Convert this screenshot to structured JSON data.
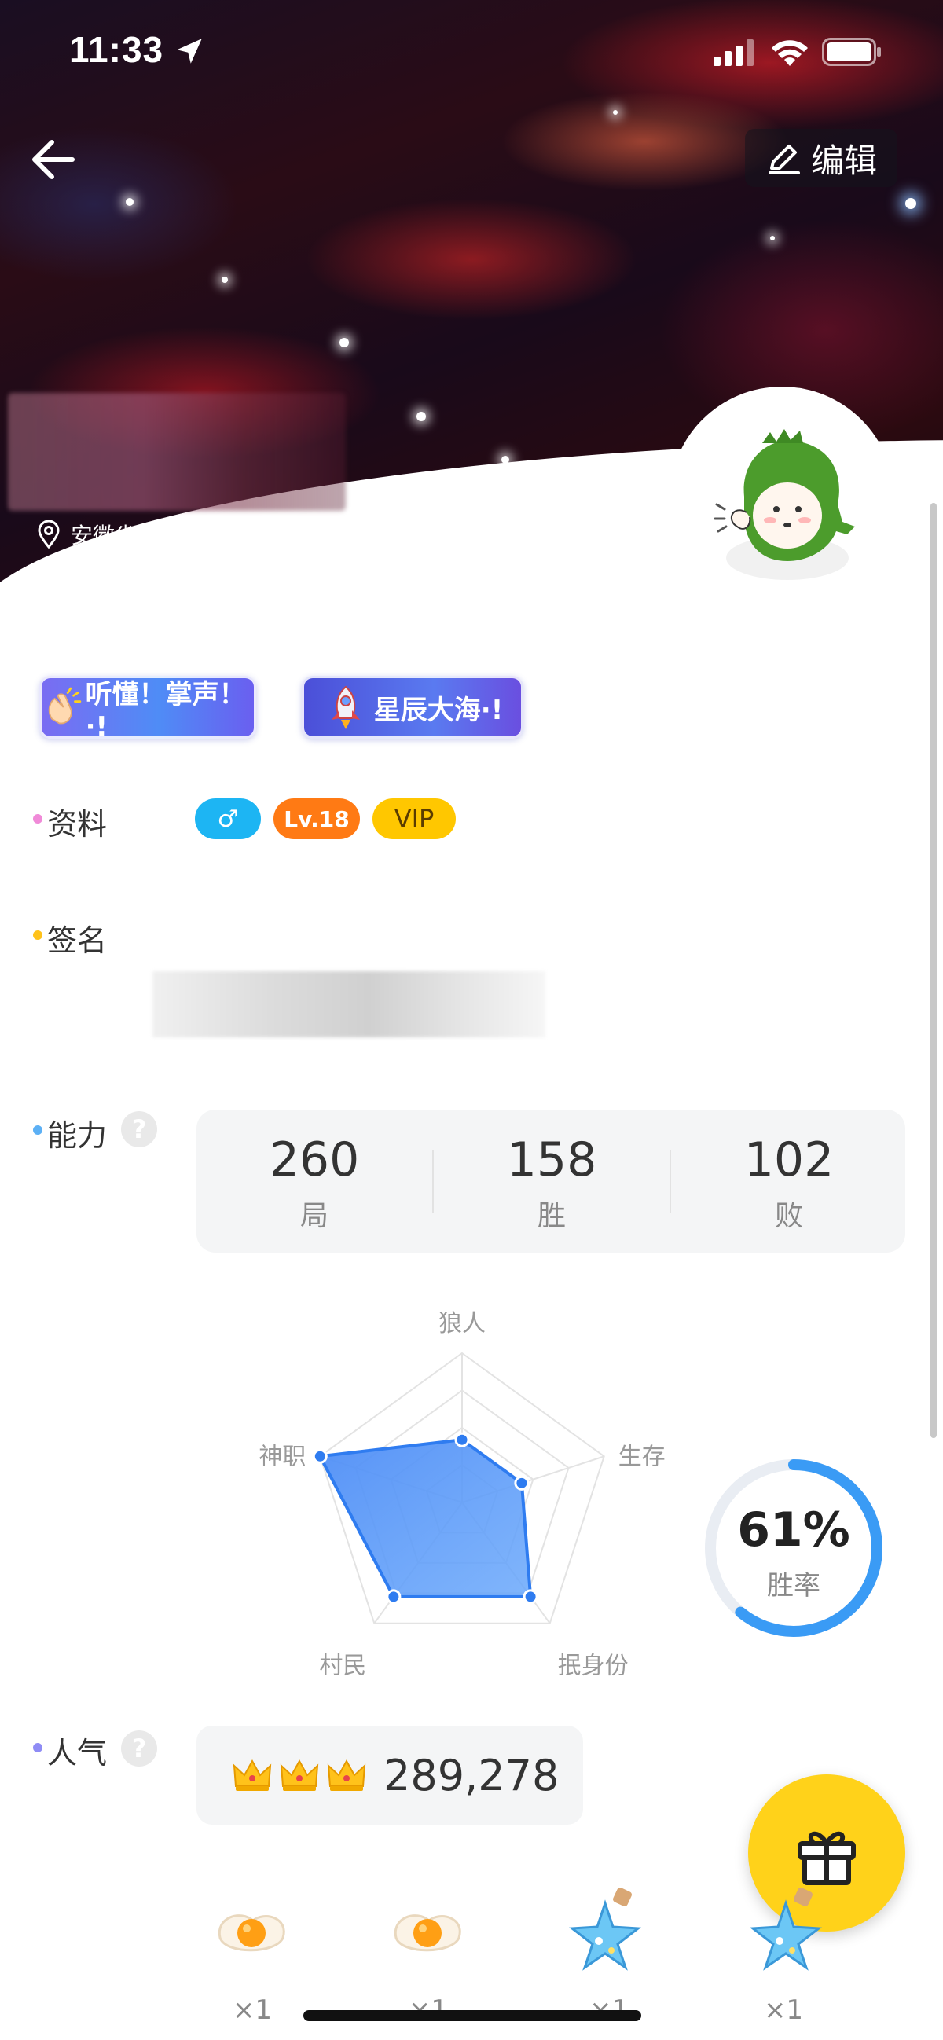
{
  "status_bar": {
    "time": "11:33",
    "icons": [
      "location-arrow-icon",
      "signal-icon",
      "wifi-icon",
      "battery-icon"
    ]
  },
  "header": {
    "back_icon": "arrow-left-icon",
    "edit_label": "编辑",
    "edit_icon": "pencil-icon",
    "location": "安徽省"
  },
  "badges": [
    {
      "label": "听懂！掌声！·!",
      "icon": "clapping-hands-icon"
    },
    {
      "label": "星辰大海·!",
      "icon": "rocket-icon"
    }
  ],
  "profile": {
    "label": "资料",
    "gender": "♂",
    "level": "Lv.18",
    "vip": "VIP"
  },
  "signature": {
    "label": "签名"
  },
  "ability": {
    "label": "能力",
    "help": "?",
    "stats": [
      {
        "value": "260",
        "caption": "局"
      },
      {
        "value": "158",
        "caption": "胜"
      },
      {
        "value": "102",
        "caption": "败"
      }
    ],
    "win_rate": "61%",
    "win_rate_label": "胜率",
    "win_rate_fraction": 0.61
  },
  "chart_data": {
    "type": "radar",
    "axes": [
      "狼人",
      "生存",
      "抿身份",
      "村民",
      "神职"
    ],
    "values": [
      0.42,
      0.42,
      0.78,
      0.78,
      1.0
    ],
    "range": [
      0,
      1
    ],
    "color": "#4a8ff5"
  },
  "popularity": {
    "label": "人气",
    "help": "?",
    "crown_icon": "crown-icon",
    "crowns": 3,
    "value": "289,278"
  },
  "gift_fab": {
    "icon": "gift-icon"
  },
  "gifts": [
    {
      "icon": "egg-icon",
      "count": "×1"
    },
    {
      "icon": "egg-icon",
      "count": "×1"
    },
    {
      "icon": "star-bottle-icon",
      "count": "×1"
    },
    {
      "icon": "star-bottle-icon",
      "count": "×1"
    }
  ],
  "colors": {
    "dot_profile": "#f08ad8",
    "dot_signature": "#ffc21a",
    "dot_ability": "#5cb0f5",
    "dot_popularity": "#8f8cf5",
    "gender": "#1db5f3",
    "level": "#ff7a14",
    "vip": "#ffc700",
    "ring": "#3a9bf5",
    "gift_fab": "#ffd21a"
  }
}
